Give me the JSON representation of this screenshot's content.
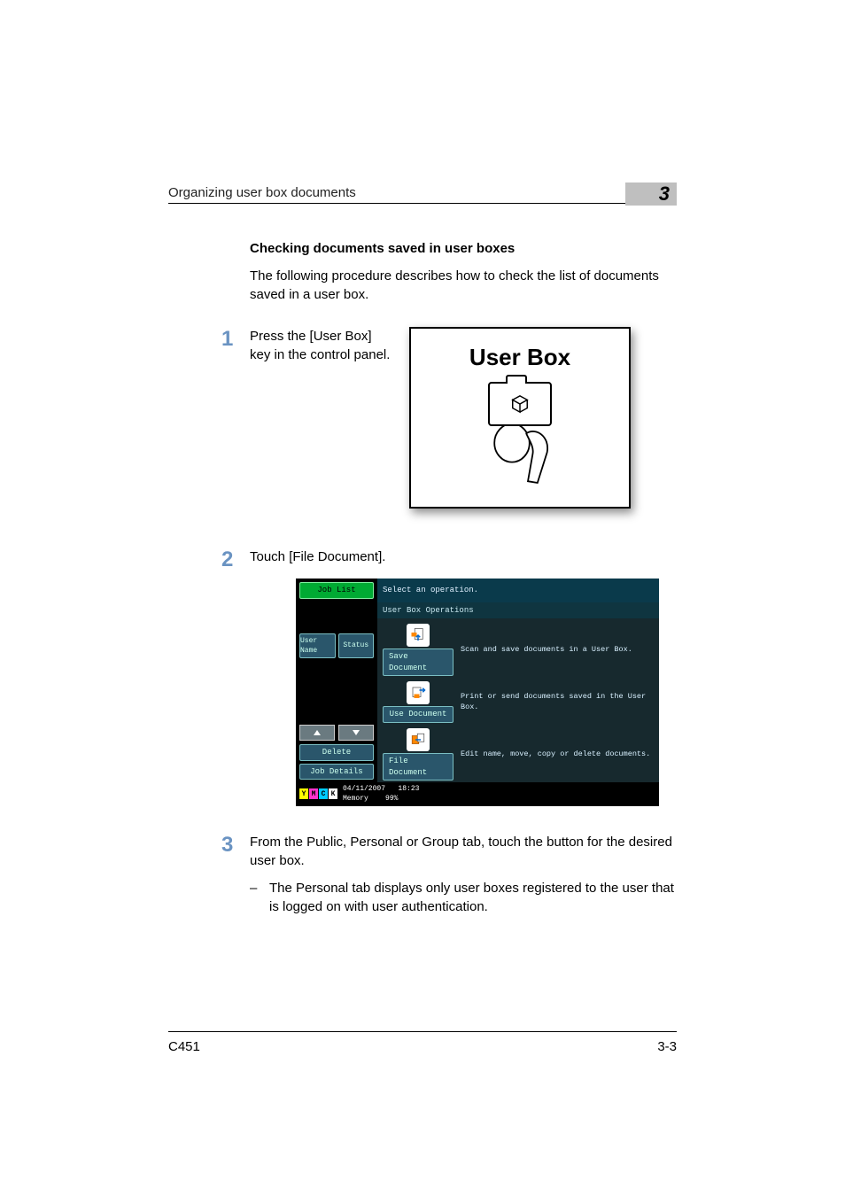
{
  "header": {
    "running_title": "Organizing user box documents",
    "chapter_number": "3"
  },
  "section": {
    "title": "Checking documents saved in user boxes",
    "intro": "The following procedure describes how to check the list of documents saved in a user box."
  },
  "steps": {
    "s1": {
      "num": "1",
      "text": "Press the [User Box] key in the control panel.",
      "figure_label": "User Box"
    },
    "s2": {
      "num": "2",
      "text": "Touch [File Document]."
    },
    "s3": {
      "num": "3",
      "text": "From the Public, Personal or Group tab, touch the button for the desired user box.",
      "bullet": "The Personal tab displays only user boxes registered to the user that is logged on with user authentication."
    }
  },
  "touchscreen": {
    "job_list": "Job List",
    "prompt": "Select an operation.",
    "subhead": "User Box Operations",
    "user_name": "User Name",
    "status": "Status",
    "ops": {
      "save": {
        "btn": "Save Document",
        "desc": "Scan and save documents in a User Box."
      },
      "use": {
        "btn": "Use Document",
        "desc": "Print or send documents saved in the User Box."
      },
      "file": {
        "btn": "File Document",
        "desc": "Edit name, move, copy or delete documents."
      }
    },
    "delete": "Delete",
    "job_details": "Job Details",
    "date": "04/11/2007",
    "time": "18:23",
    "memory_label": "Memory",
    "memory_value": "99%",
    "toner": {
      "y": "Y",
      "m": "M",
      "c": "C",
      "k": "K"
    }
  },
  "footer": {
    "model": "C451",
    "page": "3-3"
  }
}
